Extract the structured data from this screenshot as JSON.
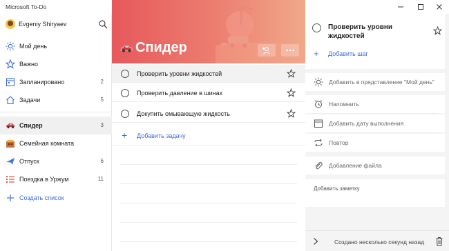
{
  "window": {
    "title": "Microsoft To-Do"
  },
  "user": {
    "name": "Evgeniy Shiryaev"
  },
  "sidebar": {
    "items": [
      {
        "label": "Мой день",
        "count": ""
      },
      {
        "label": "Важно",
        "count": ""
      },
      {
        "label": "Запланировано",
        "count": "2"
      },
      {
        "label": "Задачи",
        "count": "5"
      }
    ],
    "lists": [
      {
        "label": "Спидер",
        "count": "3"
      },
      {
        "label": "Семейная комната",
        "count": ""
      },
      {
        "label": "Отпуск",
        "count": "6"
      },
      {
        "label": "Поездка в Уржум",
        "count": "11"
      }
    ],
    "create_list_label": "Создать список"
  },
  "list": {
    "title": "Спидер",
    "tasks": [
      {
        "title": "Проверить уровни жидкостей"
      },
      {
        "title": "Проверить давление в шинах"
      },
      {
        "title": "Докупить омывающую жидкость"
      }
    ],
    "add_task_label": "Добавить задачу"
  },
  "detail": {
    "task_title": "Проверить уровни жидкостей",
    "add_step_label": "Добавить шаг",
    "add_to_my_day_label": "Добавить в представление \"Мой день\"",
    "remind_label": "Напомнить",
    "due_date_label": "Добавить дату выполнения",
    "repeat_label": "Повтор",
    "add_file_label": "Добавление файла",
    "note_placeholder": "Добавить заметку",
    "footer_status": "Создано несколько секунд назад"
  },
  "colors": {
    "accent": "#3d6dd8",
    "banner_start": "#e7585c",
    "banner_end": "#f0a98a"
  }
}
